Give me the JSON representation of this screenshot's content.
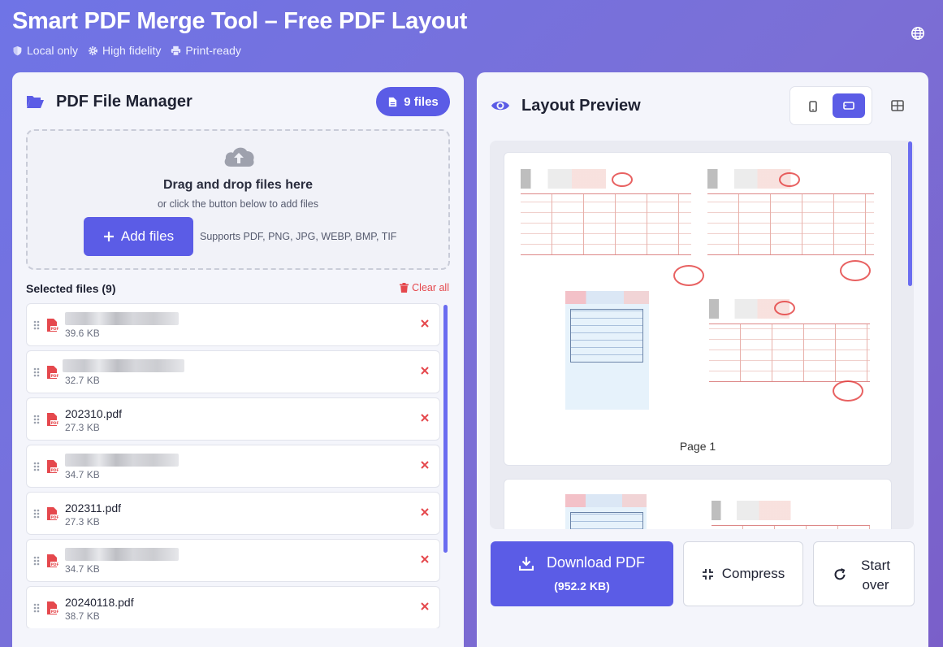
{
  "header": {
    "title": "Smart PDF Merge Tool – Free PDF Layout",
    "badges": [
      {
        "icon": "shield-icon",
        "label": "Local only"
      },
      {
        "icon": "gear-icon",
        "label": "High fidelity"
      },
      {
        "icon": "printer-icon",
        "label": "Print-ready"
      }
    ],
    "language_icon": "globe-icon"
  },
  "file_manager": {
    "title": "PDF File Manager",
    "file_count_label": "9 files",
    "dropzone": {
      "title": "Drag and drop files here",
      "subtitle": "or click the button below to add files",
      "add_button": "Add files",
      "supported": "Supports PDF, PNG, JPG, WEBP, BMP, TIF"
    },
    "selected_label": "Selected files (9)",
    "clear_all": "Clear all",
    "files": [
      {
        "name": "",
        "size": "39.6 KB",
        "name_hidden": true
      },
      {
        "name": "",
        "size": "32.7 KB",
        "name_hidden": true
      },
      {
        "name": "202310.pdf",
        "size": "27.3 KB"
      },
      {
        "name": "",
        "size": "34.7 KB",
        "name_hidden": true
      },
      {
        "name": "202311.pdf",
        "size": "27.3 KB"
      },
      {
        "name": "",
        "size": "34.7 KB",
        "name_hidden": true
      },
      {
        "name": "20240118.pdf",
        "size": "38.7 KB"
      }
    ]
  },
  "preview": {
    "title": "Layout Preview",
    "page_label": "Page 1",
    "actions": {
      "download": "Download PDF",
      "download_size": "(952.2 KB)",
      "compress": "Compress",
      "start_over_line1": "Start",
      "start_over_line2": "over"
    }
  },
  "colors": {
    "accent": "#5b5ce6",
    "danger": "#e5484d",
    "background_gradient_start": "#6f74e6",
    "background_gradient_end": "#7a5fc9"
  }
}
